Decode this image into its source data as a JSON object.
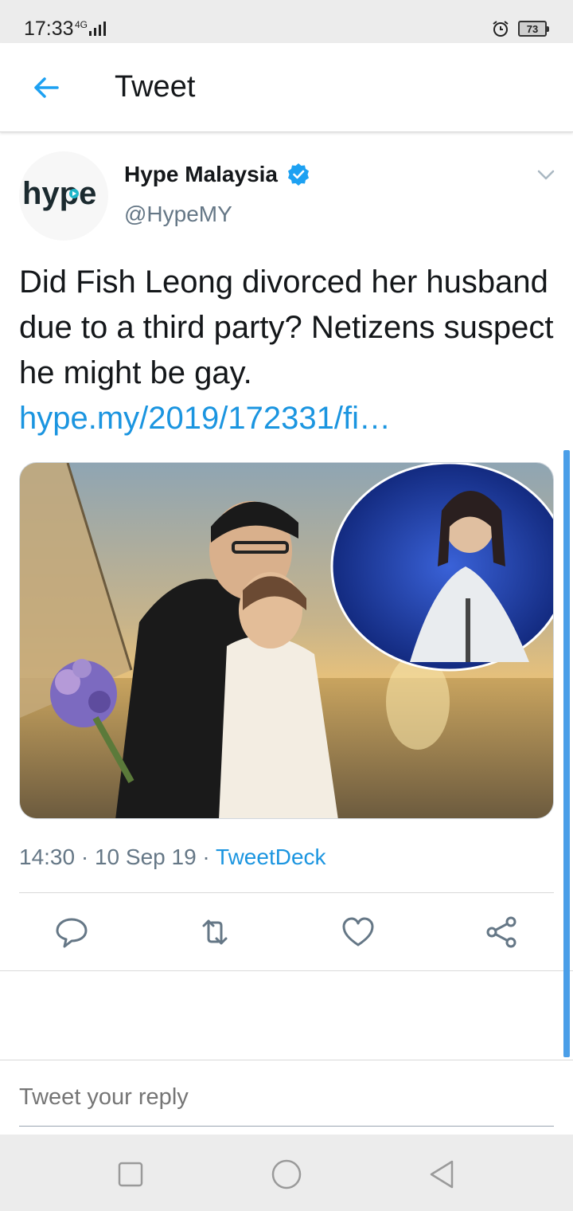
{
  "status_bar": {
    "time": "17:33",
    "network": "4G",
    "battery": "73"
  },
  "header": {
    "title": "Tweet",
    "back_icon": "back-arrow-icon"
  },
  "tweet": {
    "avatar_text": "hype",
    "author_name": "Hype Malaysia",
    "handle": "@HypeMY",
    "verified": true,
    "text": "Did Fish Leong divorced her husband due to a third party? Netizens suspect he might be gay.",
    "link": "hype.my/2019/172331/fi…",
    "time": "14:30",
    "date": "10 Sep 19",
    "source": "TweetDeck",
    "actions": [
      "reply-icon",
      "retweet-icon",
      "like-icon",
      "share-icon"
    ]
  },
  "reply": {
    "placeholder": "Tweet your reply"
  },
  "nav": {
    "buttons": [
      "recents-button",
      "home-button",
      "back-button"
    ]
  },
  "colors": {
    "accent": "#1b95e0",
    "secondary_text": "#657786",
    "primary_text": "#14171a"
  }
}
